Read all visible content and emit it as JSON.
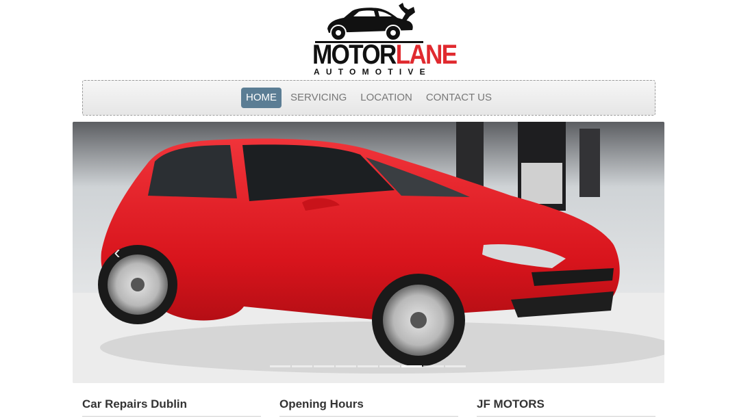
{
  "logo": {
    "word_dark": "MOTOR",
    "word_red": "LANE",
    "subtitle": "AUTOMOTIVE",
    "icon": "car-wrench-icon",
    "colors": {
      "dark": "#111111",
      "red": "#e02a2f"
    }
  },
  "nav": {
    "items": [
      {
        "label": "HOME",
        "active": true
      },
      {
        "label": "SERVICING",
        "active": false
      },
      {
        "label": "LOCATION",
        "active": false
      },
      {
        "label": "CONTACT US",
        "active": false
      }
    ],
    "active_color": "#5b7d94"
  },
  "carousel": {
    "image": "red-hatchback-car-photo",
    "prev_icon": "chevron-left-icon",
    "prev_glyph": "‹",
    "slide_count": 9,
    "active_index": 6
  },
  "columns": [
    {
      "heading": "Car Repairs Dublin"
    },
    {
      "heading": "Opening Hours"
    },
    {
      "heading": "JF MOTORS"
    }
  ]
}
